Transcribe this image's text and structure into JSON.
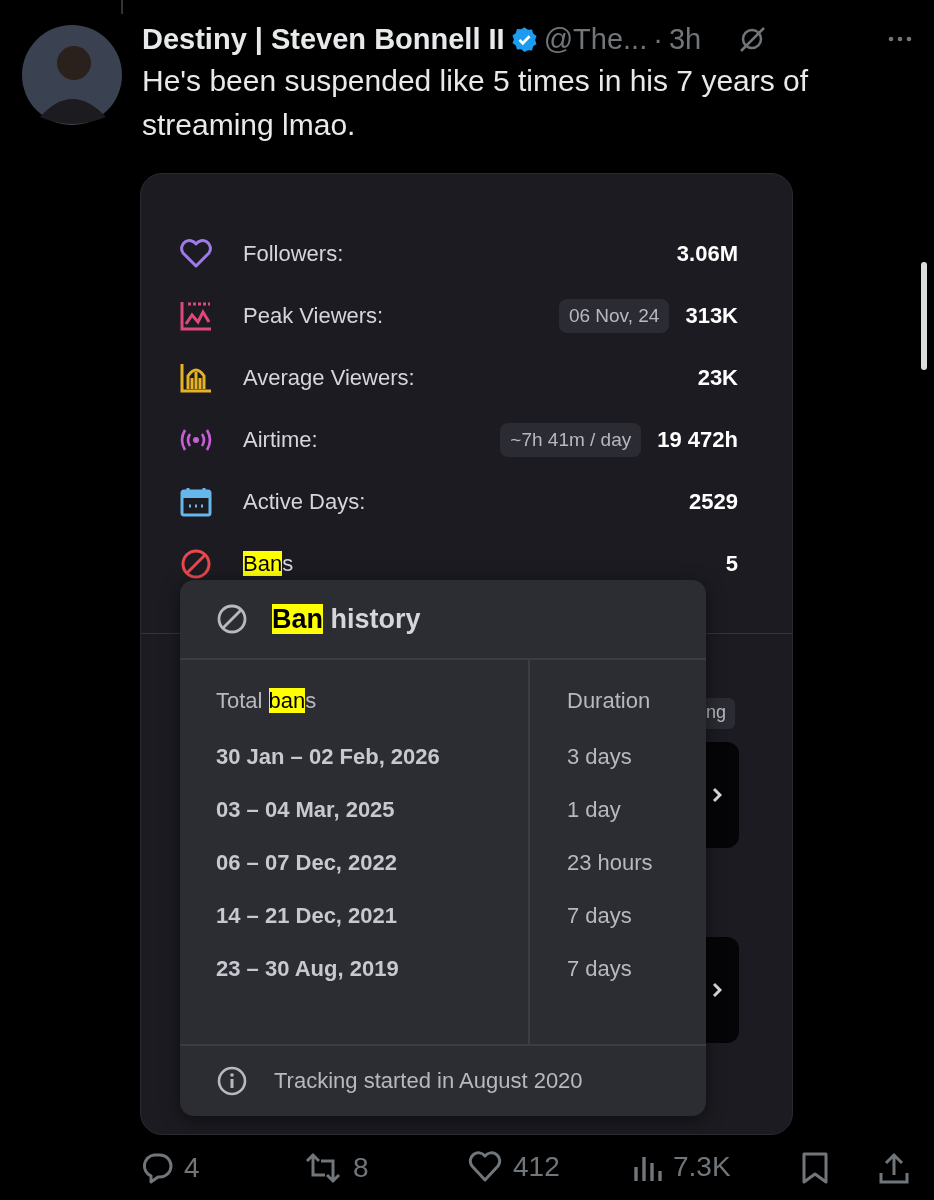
{
  "tweet": {
    "author": "Destiny | Steven Bonnell II",
    "verified": true,
    "handle": "@The...",
    "separator": "·",
    "time": "3h",
    "text": "He's been suspended like 5 times in his 7 years of streaming lmao."
  },
  "stats_card": {
    "rows": [
      {
        "kind": "heart",
        "label": "Followers:",
        "value": "3.06M"
      },
      {
        "kind": "peak",
        "label": "Peak Viewers:",
        "badge": "06 Nov, 24",
        "value": "313K"
      },
      {
        "kind": "average",
        "label": "Average Viewers:",
        "value": "23K"
      },
      {
        "kind": "broadcast",
        "label": "Airtime:",
        "badge": "~7h 41m / day",
        "value": "19 472h"
      },
      {
        "kind": "calendar",
        "label": "Active Days:",
        "value": "2529"
      },
      {
        "kind": "ban",
        "label_highlight": "Ban",
        "label_rest": "s",
        "value": "5"
      }
    ],
    "chip_text": "ng"
  },
  "ban_popup": {
    "title_highlight": "Ban",
    "title_rest": " history",
    "columns": [
      {
        "highlight_before": "Total ",
        "highlight": "ban",
        "highlight_after": "s"
      },
      {
        "text": "Duration"
      }
    ],
    "rows": [
      {
        "dates": "30 Jan – 02 Feb, 2026",
        "duration": "3 days"
      },
      {
        "dates": "03 – 04 Mar, 2025",
        "duration": "1 day"
      },
      {
        "dates": "06 – 07 Dec, 2022",
        "duration": "23 hours"
      },
      {
        "dates": "14 – 21 Dec, 2021",
        "duration": "7 days"
      },
      {
        "dates": "23 – 30 Aug, 2019",
        "duration": "7 days"
      }
    ],
    "footer": "Tracking started in August 2020"
  },
  "actions": [
    {
      "kind": "reply",
      "count": "4"
    },
    {
      "kind": "retweet",
      "count": "8"
    },
    {
      "kind": "like",
      "count": "412"
    },
    {
      "kind": "views",
      "count": "7.3K"
    },
    {
      "kind": "bookmark"
    },
    {
      "kind": "share"
    }
  ]
}
